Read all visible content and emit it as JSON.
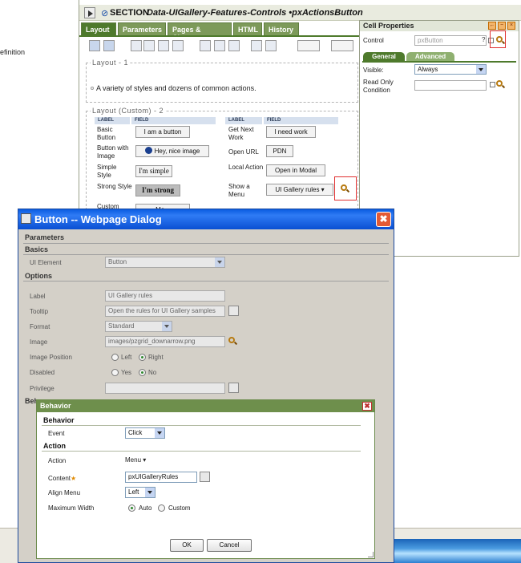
{
  "background": {
    "left_fragment": "efinition"
  },
  "section": {
    "keyword": "SECTION",
    "name": "Data-UIGallery-Features-Controls •pxActionsButton",
    "tabs": [
      "Layout",
      "Parameters",
      "Pages & Classes",
      "HTML",
      "History"
    ],
    "layout1": {
      "label": "Layout - 1",
      "text": "A variety of styles and dozens of common actions."
    },
    "layout2": {
      "label": "Layout (Custom) - 2",
      "headers": [
        "LABEL",
        "FIELD",
        "LABEL",
        "FIELD"
      ],
      "rows": [
        {
          "label1": "Basic Button",
          "button1": "I am a button",
          "label2": "Get Next Work",
          "button2": "I need work"
        },
        {
          "label1": "Button with Image",
          "button1": "Hey, nice image",
          "label2": "Open URL",
          "button2": "PDN"
        },
        {
          "label1": "Simple Style",
          "button1": "I'm simple",
          "label2": "Local Action",
          "button2": "Open in Modal"
        },
        {
          "label1": "Strong Style",
          "button1": "I'm strong",
          "label2": "Show a Menu",
          "button2": "UI Gallery rules ▾"
        },
        {
          "label1": "Custom",
          "button1": "Mo...",
          "label2": "",
          "button2": ""
        }
      ]
    }
  },
  "cell_properties": {
    "title": "Cell Properties",
    "control_label": "Control",
    "control_value": "pxButton",
    "tabs": [
      "General",
      "Advanced"
    ],
    "visible_label": "Visible:",
    "visible_value": "Always",
    "readonly_label": "Read Only Condition"
  },
  "dialog": {
    "title": "Button -- Webpage Dialog",
    "close": "✖",
    "parameters": "Parameters",
    "basics": "Basics",
    "ui_element_label": "UI Element",
    "ui_element_value": "Button",
    "options": "Options",
    "label_label": "Label",
    "label_value": "UI Gallery rules",
    "tooltip_label": "Tooltip",
    "tooltip_value": "Open the rules for UI Gallery samples",
    "format_label": "Format",
    "format_value": "Standard",
    "image_label": "Image",
    "image_value": "images/pzgrid_downarrow.png",
    "image_position_label": "Image Position",
    "left_label": "Left",
    "right_label": "Right",
    "disabled_label": "Disabled",
    "yes_label": "Yes",
    "no_label": "No",
    "privilege_label": "Privilege",
    "behav_fragment": "Behav"
  },
  "behavior": {
    "title": "Behavior",
    "close": "✖",
    "section_behavior": "Behavior",
    "event_label": "Event",
    "event_value": "Click",
    "section_action": "Action",
    "action_label": "Action",
    "action_value": "Menu",
    "content_label": "Content",
    "required_mark": "★",
    "content_value": "pxUIGalleryRules",
    "align_label": "Align Menu",
    "align_value": "Left",
    "width_label": "Maximum Width",
    "auto_label": "Auto",
    "custom_label": "Custom",
    "ok": "OK",
    "cancel": "Cancel"
  },
  "colors": {
    "tab_green": "#4e7a2c",
    "dialog_blue": "#0a5be0",
    "behavior_green": "#6e8f4c",
    "highlight_red": "#e03030"
  }
}
